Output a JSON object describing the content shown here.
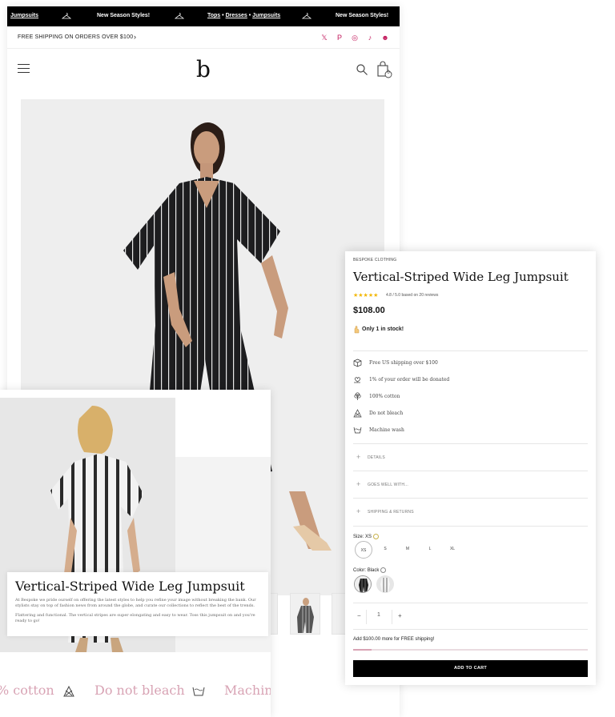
{
  "ticker": {
    "item_1": "Jumpsuits",
    "item_2": "New Season Styles!",
    "item_3_a": "Tops",
    "item_3_sep1": "•",
    "item_3_b": "Dresses",
    "item_3_sep2": "•",
    "item_3_c": "Jumpsuits",
    "item_4": "New Season Styles!"
  },
  "shipping_bar": {
    "text": "FREE SHIPPING ON ORDERS OVER $100",
    "chevron": "›",
    "social": [
      "x-icon",
      "pinterest-icon",
      "instagram-icon",
      "tiktok-icon",
      "snapchat-icon"
    ],
    "social_glyphs": [
      "𝕏",
      "P",
      "◎",
      "♪",
      "☻"
    ]
  },
  "header": {
    "logo": "b",
    "cart_count": "0"
  },
  "detail": {
    "title": "Vertical-Striped Wide Leg Jumpsuit",
    "para_1": "At Bespoke we pride ourself on offering the latest styles to help you refine your image without breaking the bank. Our stylists stay on top of fashion news from around the globe, and curate our collections to reflect the best of the trends.",
    "para_2": "Flattering and functional. The vertical stripes are super elongating and easy to wear. Toss this jumpsuit on and you're ready to go!",
    "care_1": "% cotton",
    "care_2": "Do not bleach",
    "care_3": "Machine"
  },
  "product": {
    "brand": "BESPOKE CLOTHING",
    "title": "Vertical-Striped Wide Leg Jumpsuit",
    "stars": "★★★★★",
    "rating_text": "4.8 / 5.0 based on 20 reviews",
    "price": "$108.00",
    "stock": "Only 1 in stock!",
    "features": [
      {
        "icon": "box-icon",
        "label": "Free US shipping over $100"
      },
      {
        "icon": "heart-hand-icon",
        "label": "1% of your order will be donated"
      },
      {
        "icon": "cotton-icon",
        "label": "100% cotton"
      },
      {
        "icon": "no-bleach-icon",
        "label": "Do not bleach"
      },
      {
        "icon": "machine-wash-icon",
        "label": "Machine wash"
      }
    ],
    "accordions": [
      "DETAILS",
      "GOES WELL WITH...",
      "SHIPPING & RETURNS"
    ],
    "size_label": "Size:",
    "size_value": "XS",
    "sizes": [
      "XS",
      "S",
      "M",
      "L",
      "XL"
    ],
    "color_label": "Color:",
    "color_value": "Black",
    "quantity": "1",
    "qty_minus": "−",
    "qty_plus": "+",
    "free_ship_msg": "Add $100.00 more for FREE shipping!",
    "free_ship_progress": 0.08,
    "add_to_cart": "ADD TO CART"
  }
}
